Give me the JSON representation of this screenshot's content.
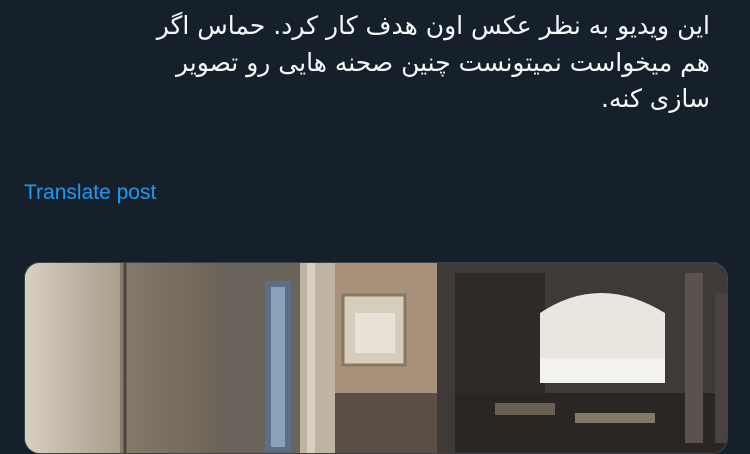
{
  "post": {
    "lines": [
      "این ویدیو به نظر عکس اون هدف کار کرد.  حماس اگر",
      "هم میخواست نمیتونست چنین صحنه هایی رو تصویر",
      "سازی کنه."
    ],
    "translate_label": "Translate post"
  },
  "colors": {
    "background": "#15202b",
    "text": "#f7f9f9",
    "link": "#1d9bf0"
  }
}
